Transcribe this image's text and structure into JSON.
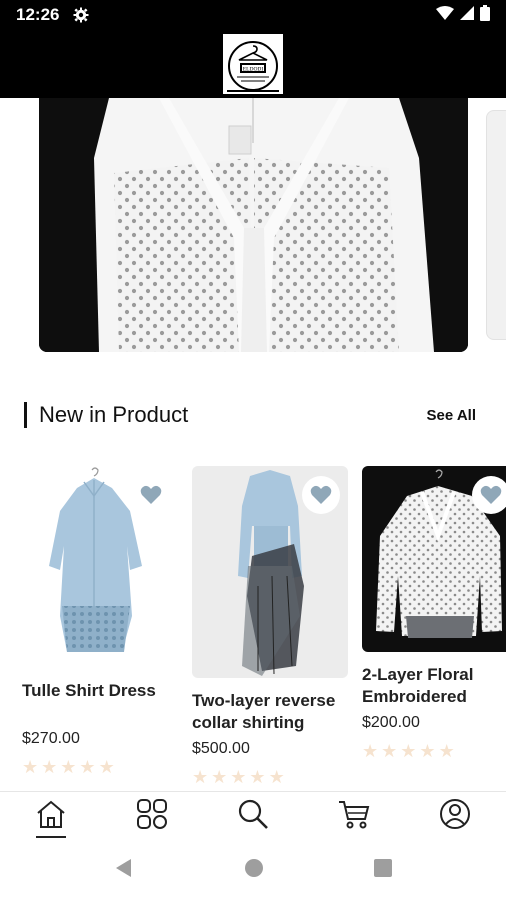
{
  "status_bar": {
    "time": "12:26",
    "icons": [
      "settings-icon",
      "wifi-icon",
      "signal-icon",
      "battery-icon"
    ]
  },
  "header": {
    "logo_text": "ELDODI"
  },
  "banner": {
    "image": "white-polka-dot-blouse"
  },
  "section": {
    "title": "New in Product",
    "see_all": "See All"
  },
  "products": [
    {
      "name": "Tulle Shirt Dress",
      "price": "$270.00",
      "image": "blue-tulle-shirt-dress",
      "rating": 0
    },
    {
      "name": "Two-layer reverse collar shirting",
      "price": "$500.00",
      "image": "blue-shirt-black-tulle-skirt",
      "rating": 0
    },
    {
      "name": "2-Layer Floral Embroidered",
      "price": "$200.00",
      "image": "white-dotted-blouse",
      "rating": 0
    }
  ],
  "bottom_nav": {
    "items": [
      "home-icon",
      "categories-icon",
      "search-icon",
      "cart-icon",
      "profile-icon"
    ],
    "active": "home-icon"
  },
  "colors": {
    "header_bg": "#000000",
    "star": "#f6e3cf",
    "favorite_heart": "#8fa7b8"
  }
}
